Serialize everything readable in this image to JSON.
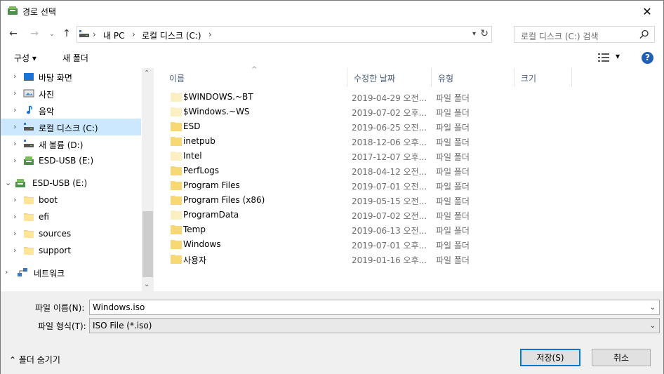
{
  "window": {
    "title": "경로 선택",
    "close_glyph": "✕"
  },
  "nav": {
    "back_glyph": "←",
    "forward_glyph": "→",
    "recent_glyph": "⌄",
    "up_glyph": "↑",
    "breadcrumbs": [
      "내 PC",
      "로컬 디스크 (C:)"
    ],
    "separator": "›",
    "search_placeholder": "로컬 디스크 (C:) 검색"
  },
  "toolbar": {
    "organize_label": "구성 ▾",
    "new_folder_label": "새 폴더",
    "view_dropdown_glyph": "▾",
    "help_glyph": "?"
  },
  "tree": {
    "items": [
      {
        "label": "바탕 화면",
        "icon": "desktop-icon",
        "chev": "›",
        "selected": false
      },
      {
        "label": "사진",
        "icon": "pictures-icon",
        "chev": "›",
        "selected": false
      },
      {
        "label": "음악",
        "icon": "music-icon",
        "chev": "›",
        "selected": false
      },
      {
        "label": "로컬 디스크 (C:)",
        "icon": "drive-icon",
        "chev": "›",
        "selected": true
      },
      {
        "label": "새 볼륨 (D:)",
        "icon": "drive-icon",
        "chev": "›",
        "selected": false
      },
      {
        "label": "ESD-USB (E:)",
        "icon": "usb-drive-icon",
        "chev": "›",
        "selected": false
      },
      {
        "label": "ESD-USB (E:)",
        "icon": "usb-drive-icon",
        "chev": "⌄",
        "selected": false
      },
      {
        "label": "boot",
        "icon": "folder-icon",
        "chev": "›",
        "selected": false
      },
      {
        "label": "efi",
        "icon": "folder-icon",
        "chev": "›",
        "selected": false
      },
      {
        "label": "sources",
        "icon": "folder-icon",
        "chev": "›",
        "selected": false
      },
      {
        "label": "support",
        "icon": "folder-icon",
        "chev": "›",
        "selected": false
      },
      {
        "label": "네트워크",
        "icon": "network-icon",
        "chev": "›",
        "selected": false
      }
    ]
  },
  "list": {
    "columns": [
      "이름",
      "수정한 날짜",
      "유형",
      "크기"
    ],
    "sort_caret": "^",
    "rows": [
      {
        "name": "$WINDOWS.~BT",
        "date": "2019-04-29 오전...",
        "type": "파일 폴더",
        "faded": true
      },
      {
        "name": "$Windows.~WS",
        "date": "2019-07-02 오후...",
        "type": "파일 폴더",
        "faded": true
      },
      {
        "name": "ESD",
        "date": "2019-06-25 오전...",
        "type": "파일 폴더",
        "faded": false
      },
      {
        "name": "inetpub",
        "date": "2018-12-06 오후...",
        "type": "파일 폴더",
        "faded": false
      },
      {
        "name": "Intel",
        "date": "2017-12-07 오후...",
        "type": "파일 폴더",
        "faded": true
      },
      {
        "name": "PerfLogs",
        "date": "2018-04-12 오전...",
        "type": "파일 폴더",
        "faded": false
      },
      {
        "name": "Program Files",
        "date": "2019-07-01 오전...",
        "type": "파일 폴더",
        "faded": false
      },
      {
        "name": "Program Files (x86)",
        "date": "2019-05-15 오전...",
        "type": "파일 폴더",
        "faded": false
      },
      {
        "name": "ProgramData",
        "date": "2019-07-02 오전...",
        "type": "파일 폴더",
        "faded": true
      },
      {
        "name": "Temp",
        "date": "2019-06-13 오전...",
        "type": "파일 폴더",
        "faded": false
      },
      {
        "name": "Windows",
        "date": "2019-07-01 오후...",
        "type": "파일 폴더",
        "faded": false
      },
      {
        "name": "사용자",
        "date": "2019-01-16 오후...",
        "type": "파일 폴더",
        "faded": false
      }
    ]
  },
  "bottom": {
    "filename_label": "파일 이름(N):",
    "filename_value": "Windows.iso",
    "filetype_label": "파일 형식(T):",
    "filetype_value": "ISO File (*.iso)",
    "hide_folders_label": "⌃  폴더 숨기기",
    "save_label": "저장(S)",
    "cancel_label": "취소"
  },
  "colors": {
    "selected_bg": "#cce8ff",
    "folder": "#f8d775",
    "folder_faded": "#fbeec2",
    "accent": "#0078d7"
  }
}
